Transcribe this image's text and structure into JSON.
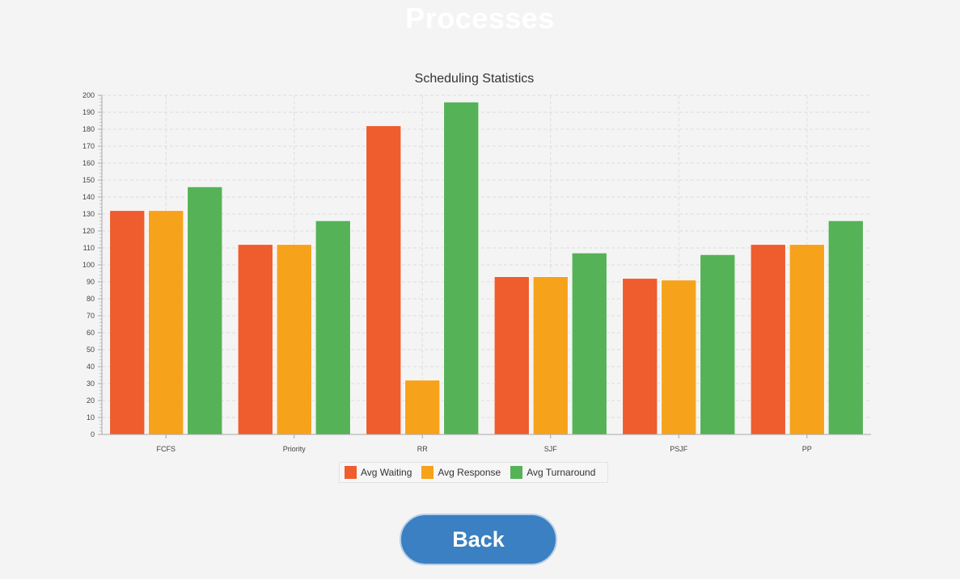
{
  "header": {
    "title": "Processes"
  },
  "chart_data": {
    "type": "bar",
    "title": "Scheduling Statistics",
    "xlabel": "",
    "ylabel": "",
    "ylim": [
      0,
      200
    ],
    "ytick_step": 10,
    "grid": true,
    "legend": "bottom-center",
    "categories": [
      "FCFS",
      "Priority",
      "RR",
      "SJF",
      "PSJF",
      "PP"
    ],
    "series": [
      {
        "name": "Avg Waiting",
        "color": "#ef5c2e",
        "values": [
          132,
          112,
          182,
          93,
          92,
          112
        ]
      },
      {
        "name": "Avg Response",
        "color": "#f7a21b",
        "values": [
          132,
          112,
          32,
          93,
          91,
          112
        ]
      },
      {
        "name": "Avg Turnaround",
        "color": "#55b257",
        "values": [
          146,
          126,
          196,
          107,
          106,
          126
        ]
      }
    ]
  },
  "footer": {
    "back_label": "Back"
  }
}
